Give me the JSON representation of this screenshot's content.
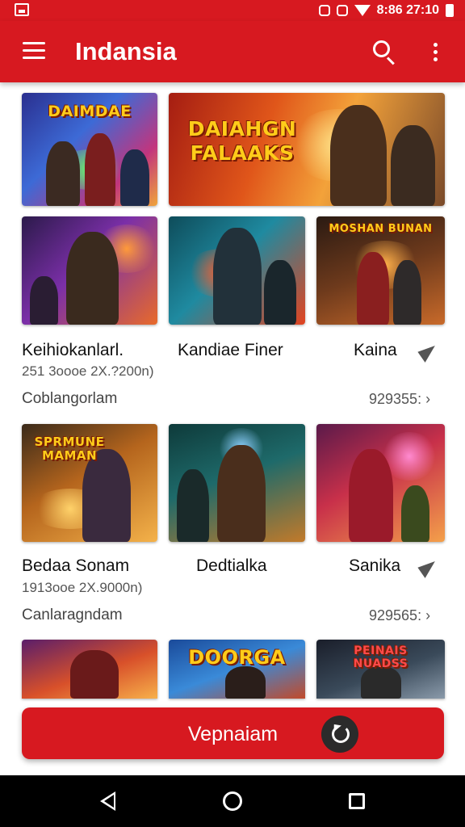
{
  "status_bar": {
    "time": "8:86 27:10"
  },
  "app_bar": {
    "title": "Indansia"
  },
  "row1": {
    "tiles": [
      {
        "logo": "DAIMDAE",
        "icon": "game-art-image"
      },
      {
        "logo": "DAIAHGN FALAAKS",
        "icon": "game-art-image"
      }
    ]
  },
  "section1": {
    "tiles": [
      {
        "logo": "",
        "icon": "game-art-image"
      },
      {
        "logo": "",
        "icon": "game-art-image"
      },
      {
        "logo": "MOSHAN BUNAN",
        "icon": "game-art-image"
      }
    ],
    "titles": [
      "Keihiokanlarl.",
      "Kandiae Finer",
      "Kaina"
    ],
    "meta": "251 3oooe 2X.?200n)",
    "footer": "Coblangorlam",
    "count": "929355:"
  },
  "section2": {
    "tiles": [
      {
        "logo": "SPRMUNE MAMAN",
        "icon": "game-art-image"
      },
      {
        "logo": "",
        "icon": "game-art-image"
      },
      {
        "logo": "",
        "icon": "game-art-image"
      }
    ],
    "titles": [
      "Bedaa Sonam",
      "Dedtialka",
      "Sanika"
    ],
    "meta": "1913ooe 2X.9000n)",
    "footer": "Canlaragndam",
    "count": "929565:"
  },
  "row4": {
    "tiles": [
      {
        "logo": "",
        "icon": "game-art-image"
      },
      {
        "logo": "DOORGA",
        "icon": "game-art-image"
      },
      {
        "logo": "PEINAIS NUADSS",
        "icon": "game-art-image"
      }
    ]
  },
  "primary_button": {
    "label": "Vepnaiam"
  },
  "colors": {
    "brand_red": "#d71920",
    "nav_black": "#000000"
  }
}
